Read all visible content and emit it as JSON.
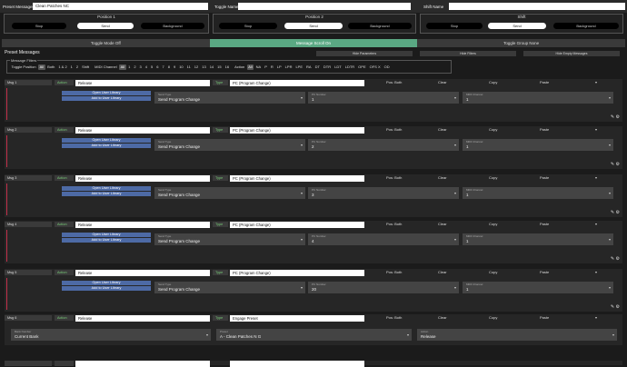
{
  "top": {
    "preset_messages_label": "Preset Messages",
    "preset_name": "Clean Patches NC",
    "toggle_name_label": "Toggle Name",
    "toggle_name_value": "",
    "shift_name_label": "Shift Name",
    "shift_name_value": ""
  },
  "positions": [
    {
      "title": "Position 1",
      "options": [
        "Stop",
        "Send",
        "Background"
      ],
      "selected": 1
    },
    {
      "title": "Position 2",
      "options": [
        "Stop",
        "Send",
        "Background"
      ],
      "selected": 1
    },
    {
      "title": "Shift",
      "options": [
        "Stop",
        "Send",
        "Background"
      ],
      "selected": 1
    }
  ],
  "mode_toggles": [
    {
      "label": "Toggle Mode Off",
      "selected": false
    },
    {
      "label": "Message Scroll On",
      "selected": true
    },
    {
      "label": "Toggle Group None",
      "selected": false
    }
  ],
  "preset_messages_title": "Preset Messages",
  "hide_buttons": [
    "Hide Parameters",
    "Hide Filters",
    "Hide Empty Messages"
  ],
  "filters": {
    "title": "Message Filters",
    "toggle_position_label": "Toggle Position",
    "toggle_positions": [
      "All",
      "Both",
      "1 & 2",
      "1",
      "2",
      "Shift"
    ],
    "midi_channel_label": "MIDI Channel",
    "midi_channels": [
      "All",
      "1",
      "2",
      "3",
      "4",
      "5",
      "6",
      "7",
      "8",
      "9",
      "10",
      "11",
      "12",
      "13",
      "14",
      "15",
      "16"
    ],
    "action_label": "Action",
    "actions": [
      "All",
      "NA",
      "P",
      "R",
      "LP",
      "LPR",
      "LPE",
      "RA",
      "DT",
      "DTR",
      "LDT",
      "LDTR",
      "OPE",
      "OFS X",
      "OD"
    ]
  },
  "messages": [
    {
      "label": "Msg 1",
      "action_label": "Action",
      "action": "Release",
      "type_label": "Type",
      "type": "PC (Program Change)",
      "pos": "Pos: Both",
      "clear": "Clear",
      "copy": "Copy",
      "paste": "Paste",
      "lib_open": "Open User Library",
      "lib_add": "Add to User Library",
      "f1_label": "Send Type",
      "f1": "Send Program Change",
      "f2_label": "PC Number",
      "f2": "1",
      "f3_label": "MIDI Channel",
      "f3": "1"
    },
    {
      "label": "Msg 2",
      "action_label": "Action",
      "action": "Release",
      "type_label": "Type",
      "type": "PC (Program Change)",
      "pos": "Pos: Both",
      "clear": "Clear",
      "copy": "Copy",
      "paste": "Paste",
      "lib_open": "Open User Library",
      "lib_add": "Add to User Library",
      "f1_label": "Send Type",
      "f1": "Send Program Change",
      "f2_label": "PC Number",
      "f2": "2",
      "f3_label": "MIDI Channel",
      "f3": "1"
    },
    {
      "label": "Msg 3",
      "action_label": "Action",
      "action": "Release",
      "type_label": "Type",
      "type": "PC (Program Change)",
      "pos": "Pos: Both",
      "clear": "Clear",
      "copy": "Copy",
      "paste": "Paste",
      "lib_open": "Open User Library",
      "lib_add": "Add to User Library",
      "f1_label": "Send Type",
      "f1": "Send Program Change",
      "f2_label": "PC Number",
      "f2": "3",
      "f3_label": "MIDI Channel",
      "f3": "1"
    },
    {
      "label": "Msg 4",
      "action_label": "Action",
      "action": "Release",
      "type_label": "Type",
      "type": "PC (Program Change)",
      "pos": "Pos: Both",
      "clear": "Clear",
      "copy": "Copy",
      "paste": "Paste",
      "lib_open": "Open User Library",
      "lib_add": "Add to User Library",
      "f1_label": "Send Type",
      "f1": "Send Program Change",
      "f2_label": "PC Number",
      "f2": "4",
      "f3_label": "MIDI Channel",
      "f3": "1"
    },
    {
      "label": "Msg 5",
      "action_label": "Action",
      "action": "Release",
      "type_label": "Type",
      "type": "PC (Program Change)",
      "pos": "Pos: Both",
      "clear": "Clear",
      "copy": "Copy",
      "paste": "Paste",
      "lib_open": "Open User Library",
      "lib_add": "Add to User Library",
      "f1_label": "Send Type",
      "f1": "Send Program Change",
      "f2_label": "PC Number",
      "f2": "20",
      "f3_label": "MIDI Channel",
      "f3": "1"
    }
  ],
  "msg6": {
    "label": "Msg 6",
    "action_label": "Action",
    "action": "Release",
    "type_label": "Type",
    "type": "Engage Preset",
    "pos": "Pos: Both",
    "clear": "Clear",
    "copy": "Copy",
    "paste": "Paste",
    "f1_label": "Bank Number",
    "f1": "Current Bank",
    "f2_label": "Preset",
    "f2": "A - Clean Patches N G",
    "f3_label": "Action",
    "f3": "Release"
  },
  "icons": {
    "edit": "pencil-icon",
    "settings": "gear-icon",
    "caret": "chevron-down-icon"
  }
}
